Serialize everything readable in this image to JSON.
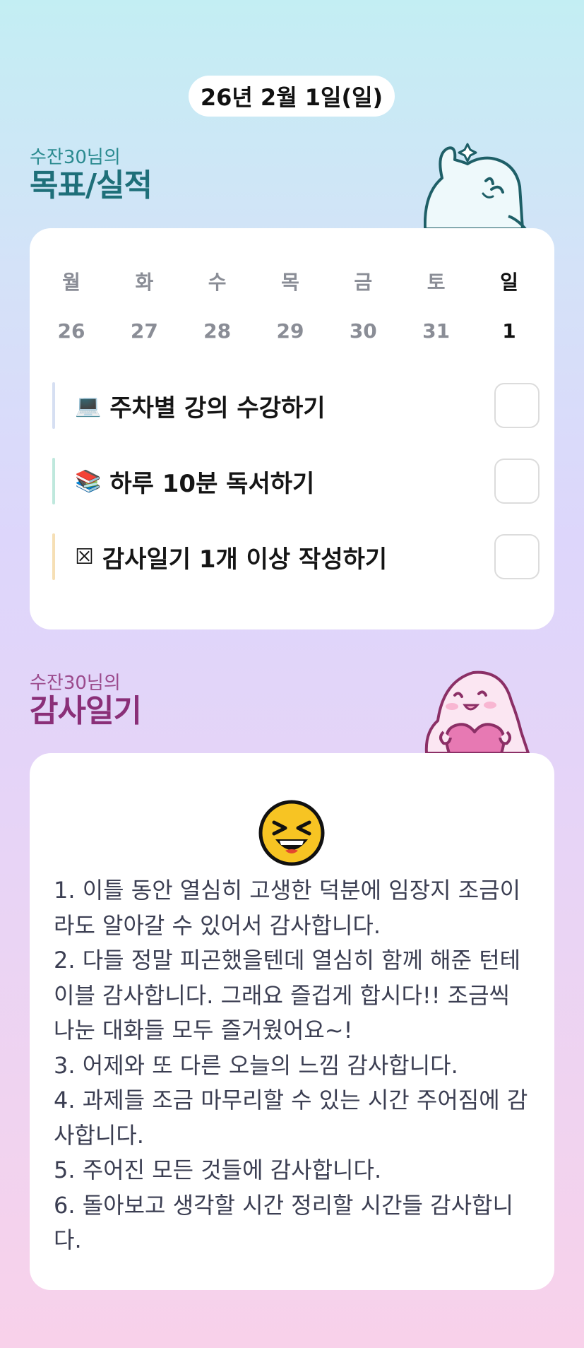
{
  "header": {
    "date": "26년 2월 1일(일)"
  },
  "goals_section": {
    "subtitle": "수잔30님의",
    "title": "목표/실적",
    "subtitle_color": "#2a8a8f",
    "title_color": "#1e6f79"
  },
  "calendar": {
    "weekdays": [
      "월",
      "화",
      "수",
      "목",
      "금",
      "토",
      "일"
    ],
    "dates": [
      "26",
      "27",
      "28",
      "29",
      "30",
      "31",
      "1"
    ],
    "selected_index": 6
  },
  "goals": [
    {
      "icon": "💻",
      "icon_name": "laptop-icon",
      "label": "주차별 강의 수강하기",
      "bar_color": "#d6dff2",
      "checked": false
    },
    {
      "icon": "📚",
      "icon_name": "books-icon",
      "label": "하루 10분 독서하기",
      "bar_color": "#bfe8dd",
      "checked": false
    },
    {
      "icon": "☒",
      "icon_name": "checkbox-icon",
      "label": "감사일기 1개 이상 작성하기",
      "bar_color": "#f6dfb5",
      "checked": false
    }
  ],
  "journal_section": {
    "subtitle": "수잔30님의",
    "title": "감사일기",
    "subtitle_color": "#9b4a8c",
    "title_color": "#8a2f78"
  },
  "journal": {
    "emoji_name": "laughing-face-icon",
    "lines": [
      "1. 이틀 동안 열심히 고생한 덕분에 임장지 조금이라도 알아갈 수 있어서 감사합니다.",
      "2. 다들 정말 피곤했을텐데 열심히 함께 해준 턴테이블 감사합니다. 그래요 즐겁게 합시다!! 조금씩 나눈 대화들 모두 즐거웠어요~!",
      "3. 어제와 또 다른 오늘의 느낌 감사합니다.",
      "4. 과제들 조금 마무리할 수 있는 시간 주어짐에 감사합니다.",
      "5. 주어진 모든 것들에 감사합니다.",
      "6. 돌아보고 생각할 시간 정리할 시간들 감사합니다."
    ]
  }
}
